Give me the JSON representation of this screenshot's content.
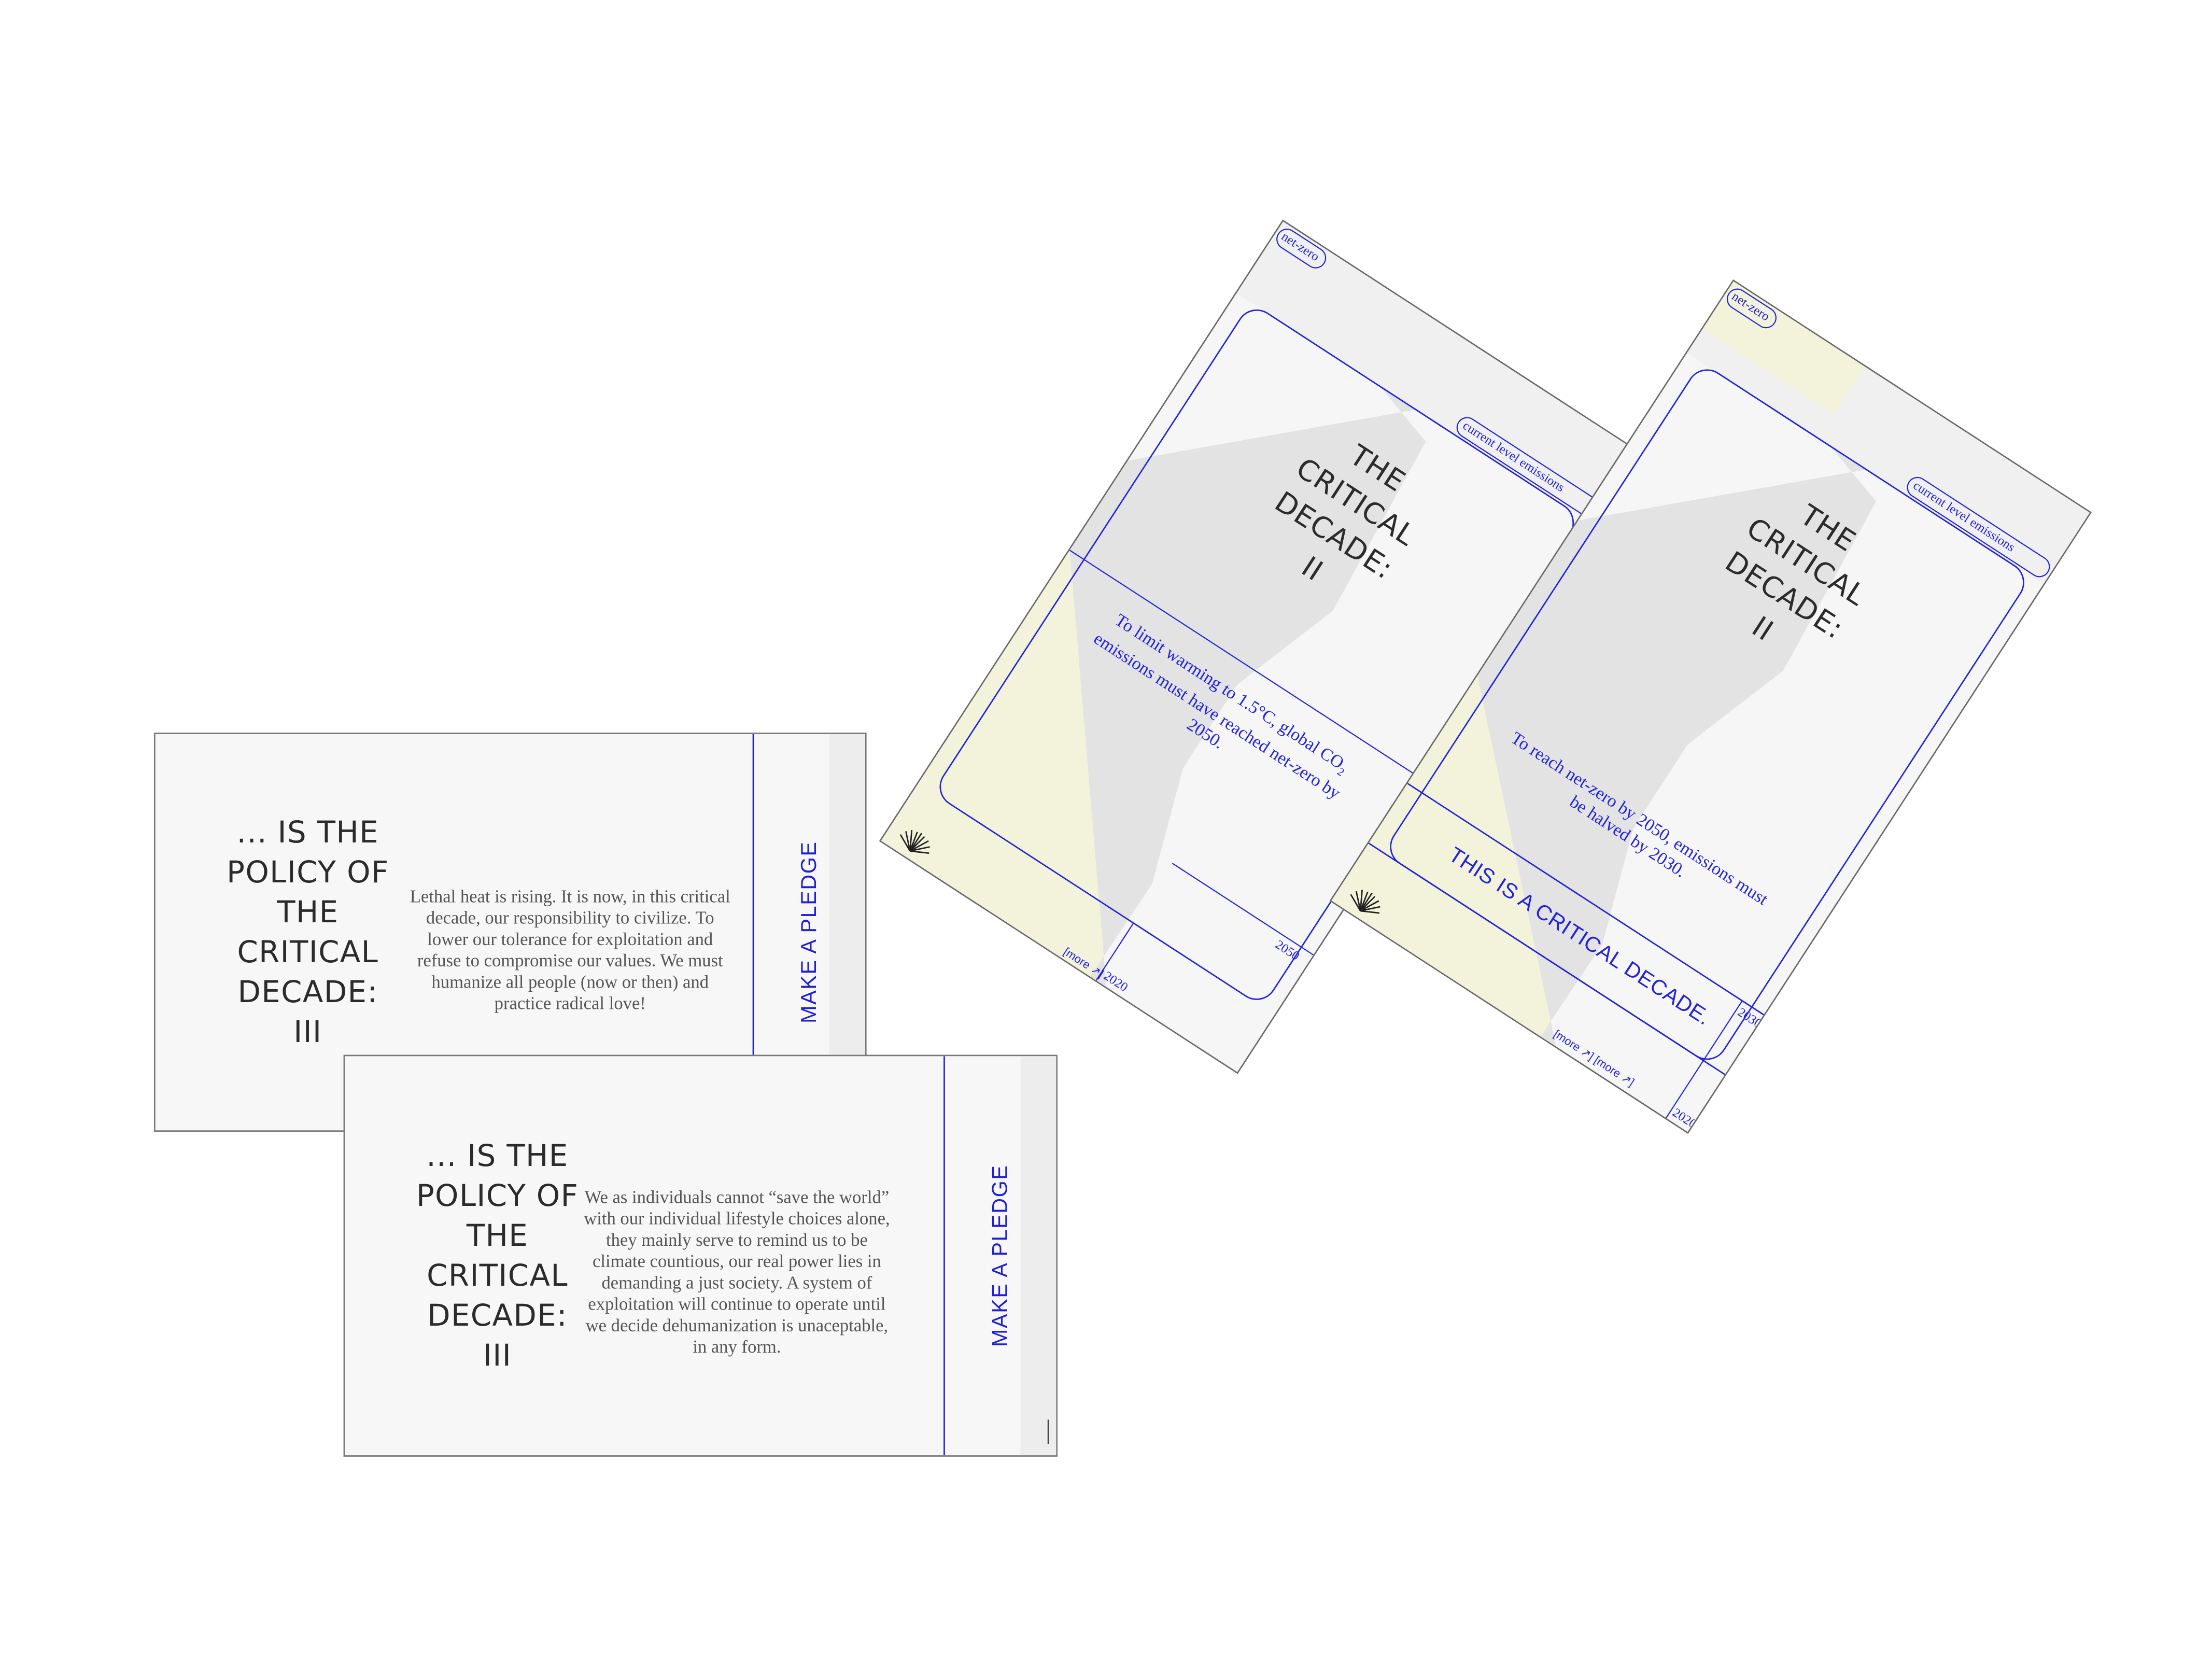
{
  "colors": {
    "accent_blue": "#2323d8",
    "yellow_area": "#f3f3dc",
    "gray_area": "#e3e3e3",
    "card_bg": "#f6f6f6"
  },
  "card_iii_a": {
    "title_lines": [
      "... IS THE",
      "POLICY OF",
      "THE",
      "CRITICAL",
      "DECADE:"
    ],
    "numeral": "III",
    "body": "Lethal heat is rising. It is now, in this critical decade, our responsibility to civilize. To lower our tolerance for exploitation and refuse to compromise our values. We must humanize all people (now or then) and practice radical love!",
    "pledge": "MAKE A PLEDGE"
  },
  "card_iii_b": {
    "title_lines": [
      "... IS THE",
      "POLICY OF",
      "THE",
      "CRITICAL",
      "DECADE:"
    ],
    "numeral": "III",
    "body": "We as individuals cannot “save the world” with our individual lifestyle choices alone, they mainly serve to remind us to be climate countious, our real power lies in demanding a just society. A system of exploitation will continue to operate until we decide dehumanization is unaceptable, in any form.",
    "pledge": "MAKE A PLEDGE"
  },
  "poster_ii_a": {
    "title_lines": [
      "THE",
      "CRITICAL",
      "DECADE:"
    ],
    "numeral": "II",
    "label_net_zero": "net-zero",
    "label_current": "current level emissions",
    "body_pre": "To limit warming to 1.5°C, global CO",
    "body_sub": "2",
    "body_post": "emissions must have reached net-zero by 2050.",
    "year_top": "2050",
    "year_bottom": "2020",
    "more": "[more ↗]"
  },
  "poster_ii_b": {
    "title_lines": [
      "THE",
      "CRITICAL",
      "DECADE:"
    ],
    "numeral": "II",
    "label_net_zero": "net-zero",
    "label_current": "current level emissions",
    "body": "To reach net-zero by 2050, emissions must be halved by 2030.",
    "banner": "THIS IS A CRITICAL DECADE.",
    "year_top": "2030",
    "year_bottom": "2020",
    "more": "[more ↗] [more ↗]"
  },
  "icons": {
    "logo": "fan-icon"
  }
}
